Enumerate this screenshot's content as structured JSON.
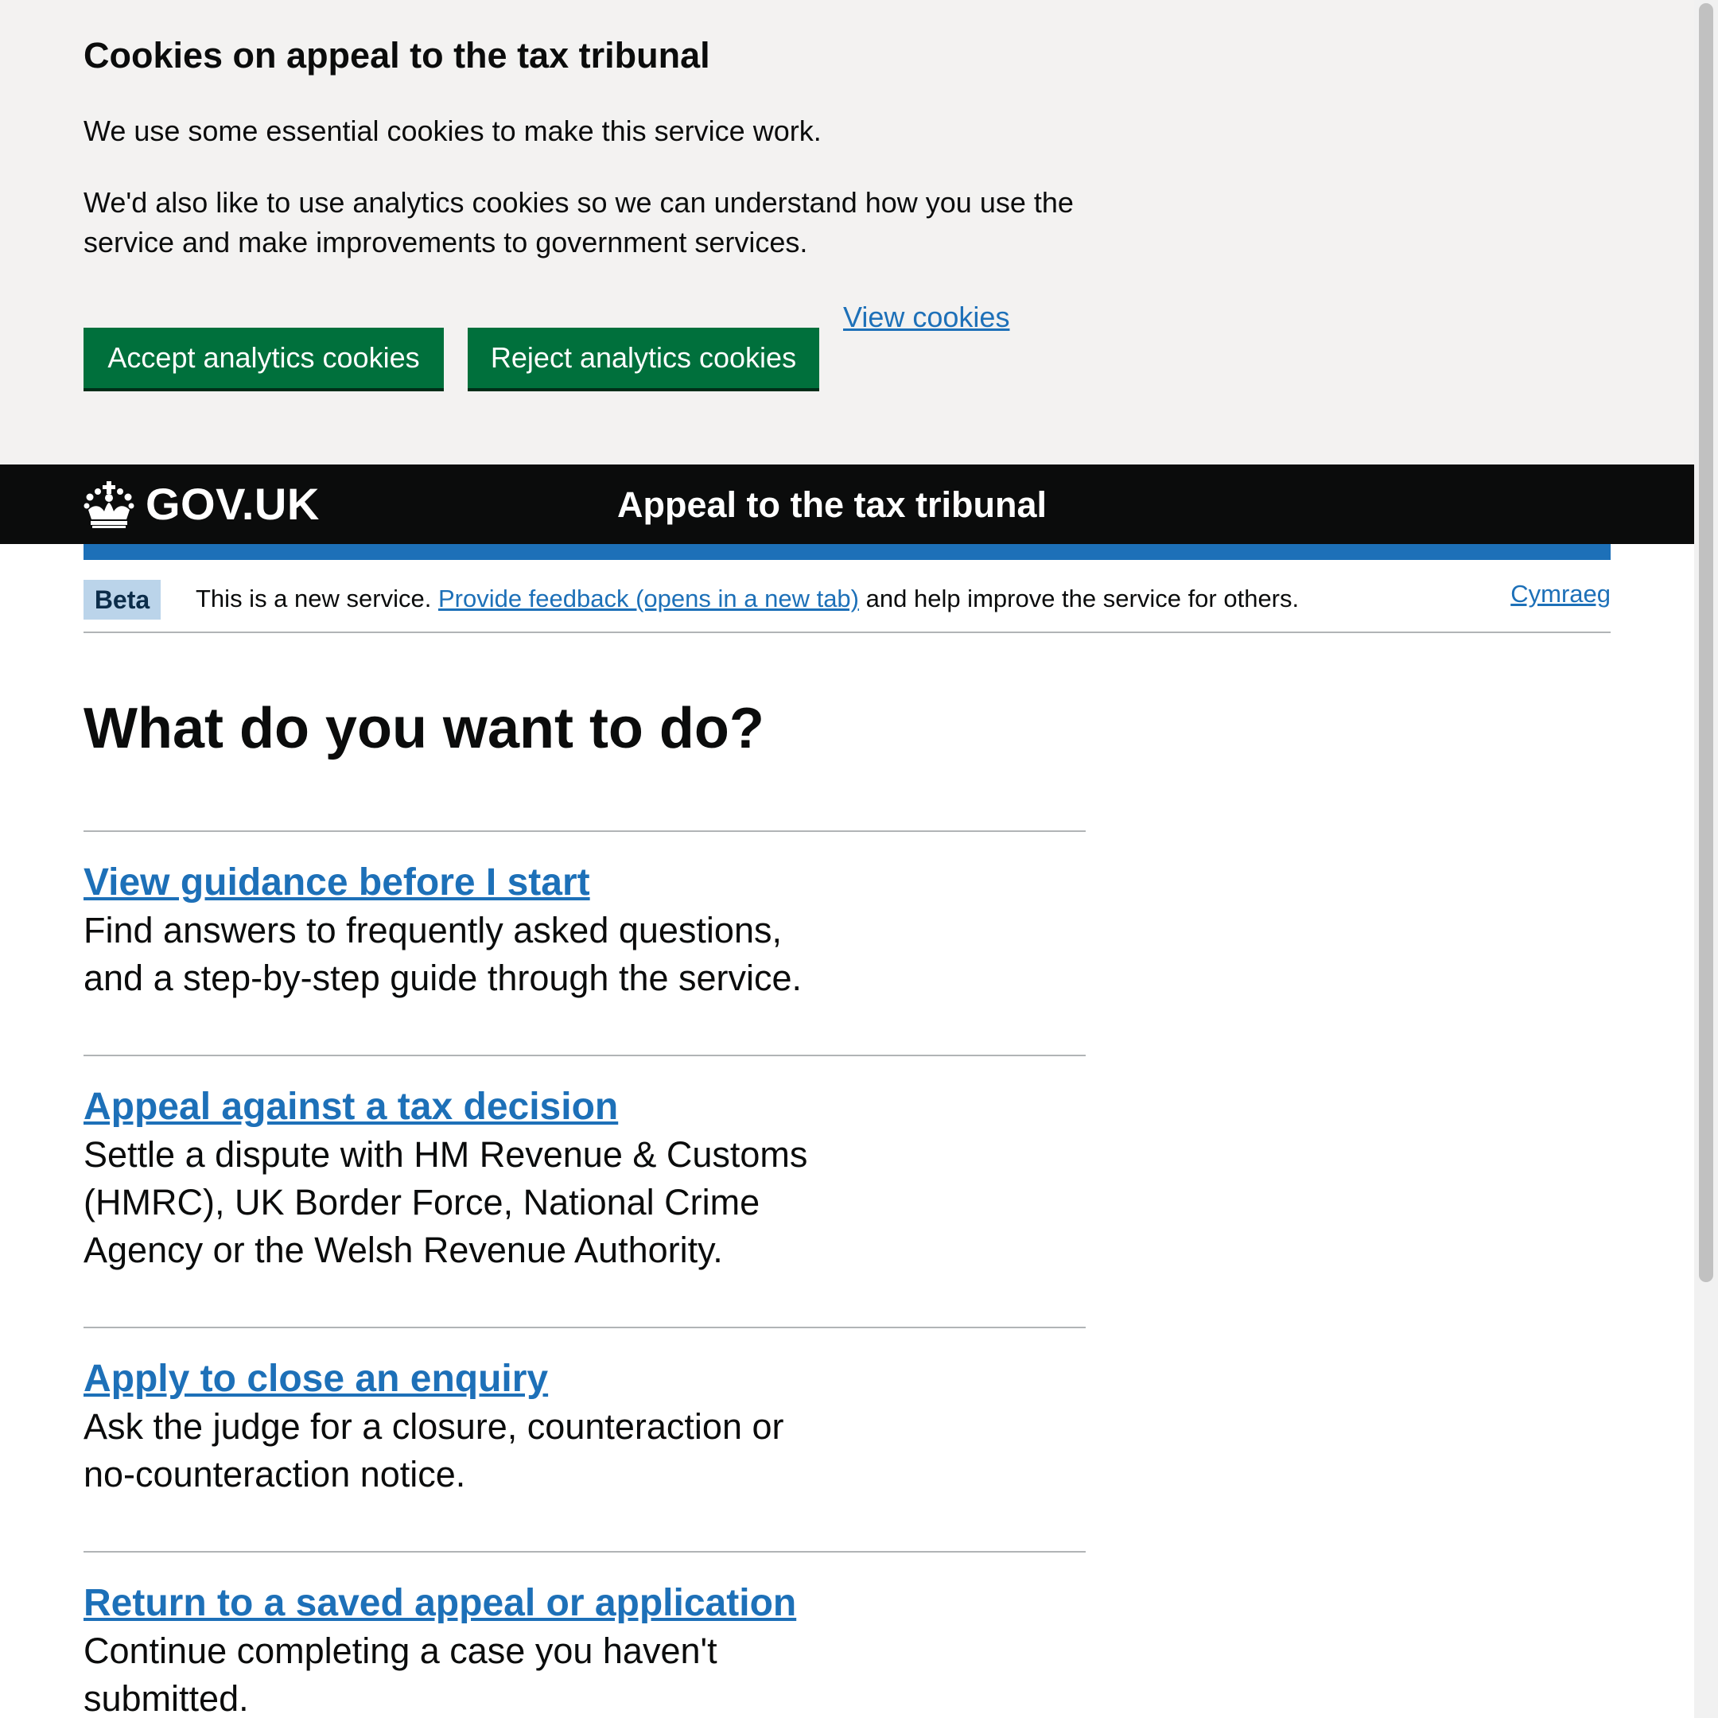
{
  "cookie_banner": {
    "title": "Cookies on appeal to the tax tribunal",
    "paragraph_1": "We use some essential cookies to make this service work.",
    "paragraph_2": "We'd also like to use analytics cookies so we can understand how you use the service and make improvements to government services.",
    "accept_label": "Accept analytics cookies",
    "reject_label": "Reject analytics cookies",
    "view_cookies_label": "View cookies"
  },
  "header": {
    "logo_text": "GOV.UK",
    "logo_icon": "crown-icon",
    "service_name": "Appeal to the tax tribunal"
  },
  "phase_banner": {
    "tag": "Beta",
    "text_before": "This is a new service.",
    "feedback_link": "Provide feedback (opens in a new tab)",
    "text_after": "and help improve the service for others.",
    "language_link": "Cymraeg"
  },
  "main": {
    "heading": "What do you want to do?",
    "options": [
      {
        "link": "View guidance before I start",
        "description": "Find answers to frequently asked questions, and a step-by-step guide through the service."
      },
      {
        "link": "Appeal against a tax decision",
        "description": "Settle a dispute with HM Revenue & Customs (HMRC), UK Border Force, National Crime Agency or the Welsh Revenue Authority."
      },
      {
        "link": "Apply to close an enquiry",
        "description": "Ask the judge for a closure, counteraction or no-counteraction notice."
      },
      {
        "link": "Return to a saved appeal or application",
        "description": "Continue completing a case you haven't submitted."
      }
    ]
  },
  "colors": {
    "button_green": "#00703c",
    "link_blue": "#1d70b8",
    "header_black": "#0b0c0c",
    "banner_grey": "#f3f2f1",
    "beta_tag_bg": "#bbd4ea"
  }
}
